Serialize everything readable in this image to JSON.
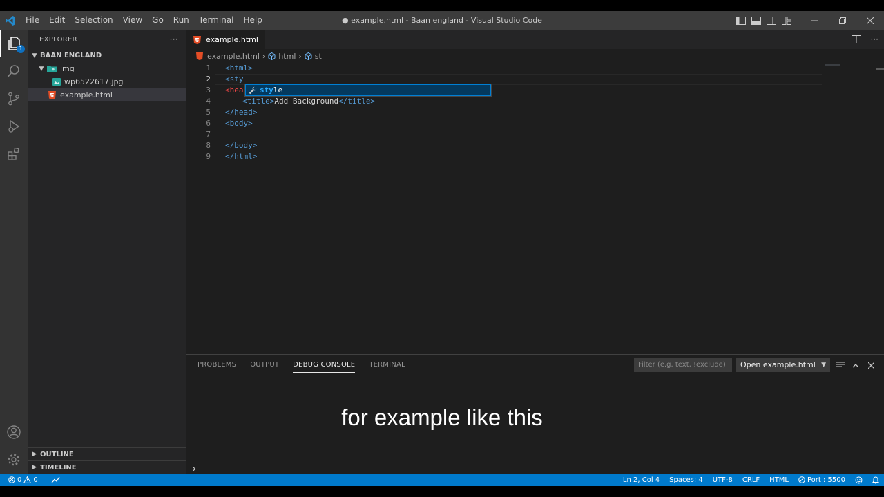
{
  "window": {
    "title": "● example.html - Baan england - Visual Studio Code"
  },
  "menu": [
    "File",
    "Edit",
    "Selection",
    "View",
    "Go",
    "Run",
    "Terminal",
    "Help"
  ],
  "activity_bar": {
    "explorer_badge": "1"
  },
  "sidebar": {
    "header": "EXPLORER",
    "more_label": "···",
    "workspace": "BAAN ENGLAND",
    "folder": "img",
    "image_file": "wp6522617.jpg",
    "html_file": "example.html",
    "outline": "OUTLINE",
    "timeline": "TIMELINE"
  },
  "editor": {
    "tab_label": "example.html",
    "breadcrumb": {
      "file": "example.html",
      "node1": "html",
      "node2": "st"
    },
    "line_numbers": [
      "1",
      "2",
      "3",
      "4",
      "5",
      "6",
      "7",
      "8",
      "9"
    ],
    "lines": {
      "l1_tag": "<html>",
      "l2_tag": "<sty",
      "l3_tag": "<hea",
      "l4_open": "<title>",
      "l4_text": "Add Background",
      "l4_close": "</title>",
      "l5_tag": "</head>",
      "l6_tag": "<body>",
      "l8_tag": "</body>",
      "l9_tag": "</html>"
    },
    "suggestion": {
      "match": "sty",
      "rest": "le"
    }
  },
  "panel": {
    "tabs": [
      "PROBLEMS",
      "OUTPUT",
      "DEBUG CONSOLE",
      "TERMINAL"
    ],
    "active_tab": "DEBUG CONSOLE",
    "filter_placeholder": "Filter (e.g. text, !exclude)",
    "select_value": "Open example.html",
    "prompt": "›"
  },
  "subtitle": "for example like this",
  "statusbar": {
    "errors": "0",
    "warnings": "0",
    "position": "Ln 2, Col 4",
    "spaces": "Spaces: 4",
    "encoding": "UTF-8",
    "eol": "CRLF",
    "language": "HTML",
    "port": "Port : 5500"
  },
  "colors": {
    "accent": "#007acc",
    "html_icon": "#e44d26",
    "image_icon": "#26a69a"
  }
}
